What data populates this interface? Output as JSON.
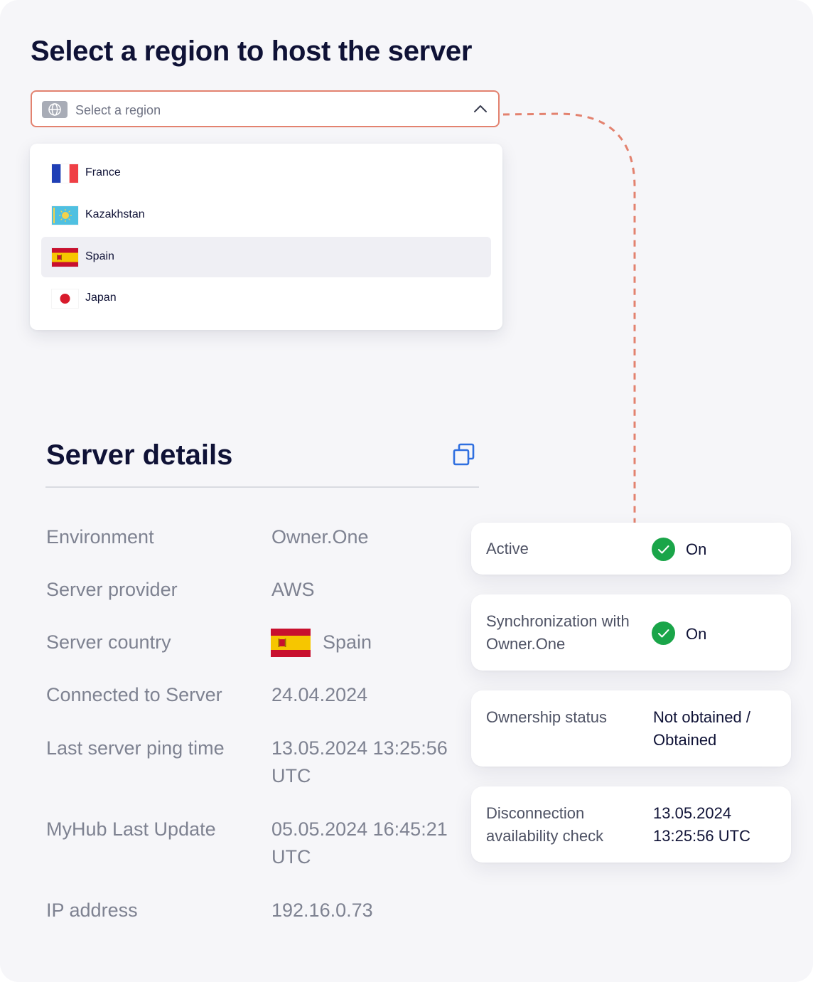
{
  "colors": {
    "accent": "#e3826f",
    "heading": "#0f1236",
    "muted": "#7e8291",
    "selected_row": "#efeff4",
    "success": "#1aa549",
    "copy_icon": "#2f6fe0"
  },
  "region_select": {
    "title": "Select a region to host the server",
    "placeholder": "Select a region",
    "icon": "globe-icon",
    "expanded_icon": "chevron-up-icon",
    "options": [
      {
        "label": "France",
        "flag": "france-flag"
      },
      {
        "label": "Kazakhstan",
        "flag": "kazakhstan-flag"
      },
      {
        "label": "Spain",
        "flag": "spain-flag",
        "selected": true
      },
      {
        "label": "Japan",
        "flag": "japan-flag"
      }
    ]
  },
  "server_details": {
    "title": "Server details",
    "copy_icon": "copy-icon",
    "rows": [
      {
        "label": "Environment",
        "value": "Owner.One"
      },
      {
        "label": "Server provider",
        "value": "AWS"
      },
      {
        "label": "Server country",
        "value": "Spain"
      },
      {
        "label": "Connected to Server",
        "value": "24.04.2024"
      },
      {
        "label": "Last server ping time",
        "value": "13.05.2024 13:25:56 UTC"
      },
      {
        "label": "MyHub Last Update",
        "value": "05.05.2024 16:45:21 UTC"
      },
      {
        "label": "IP address",
        "value": "192.16.0.73"
      }
    ]
  },
  "status_cards": [
    {
      "label": "Active",
      "value": "On",
      "icon": "check-circle-icon"
    },
    {
      "label": "Synchronization with Owner.One",
      "value": "On",
      "icon": "check-circle-icon"
    },
    {
      "label": "Ownership status",
      "value": "Not obtained / Obtained"
    },
    {
      "label": "Disconnection availability check",
      "value": "13.05.2024 13:25:56 UTC"
    }
  ]
}
